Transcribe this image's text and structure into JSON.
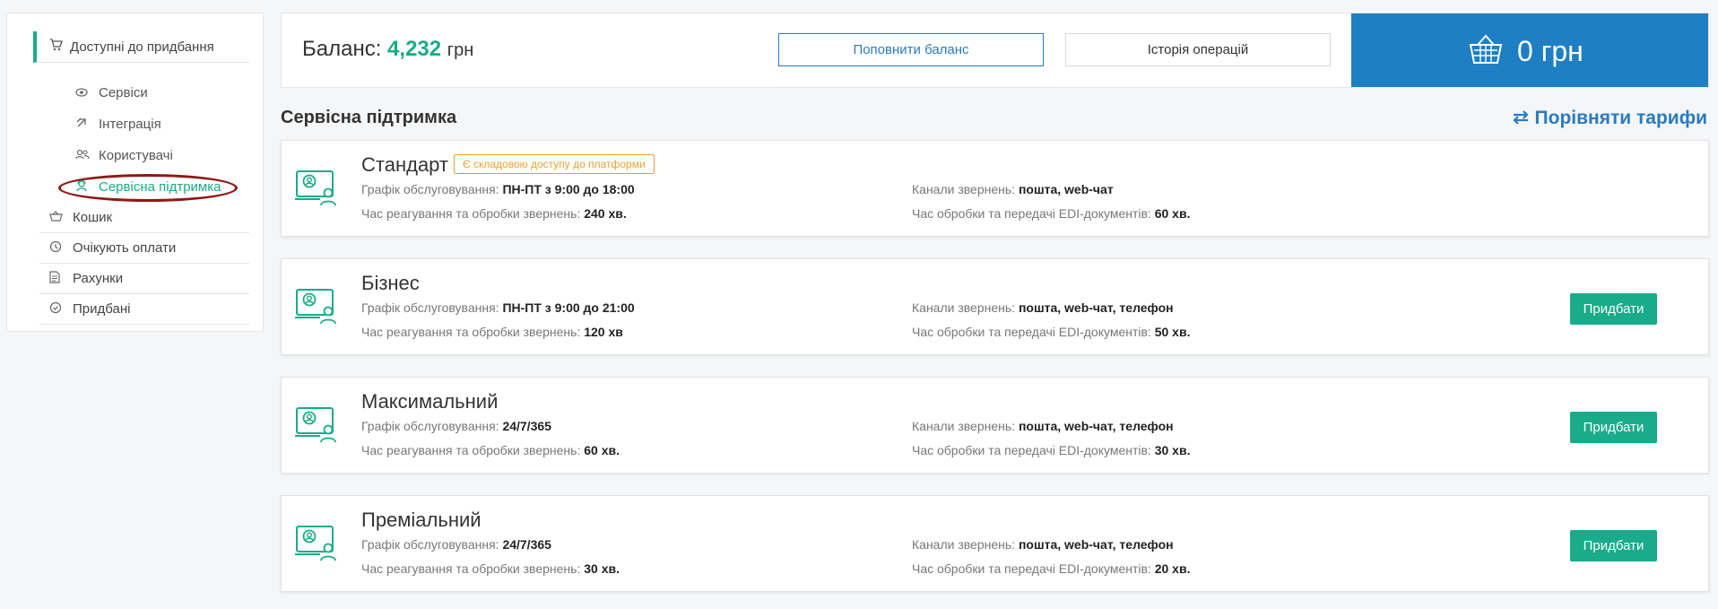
{
  "sidebar": {
    "header": {
      "label": "Доступні до придбання",
      "icon": "cart-icon"
    },
    "sub_items": [
      {
        "label": "Сервіси",
        "icon": "eye-icon",
        "active": false
      },
      {
        "label": "Інтеграція",
        "icon": "integration-icon",
        "active": false
      },
      {
        "label": "Користувачі",
        "icon": "users-icon",
        "active": false
      },
      {
        "label": "Сервісна підтримка",
        "icon": "support-icon",
        "active": true
      }
    ],
    "main_items": [
      {
        "label": "Кошик",
        "icon": "basket-icon"
      },
      {
        "label": "Очікують оплати",
        "icon": "clock-icon"
      },
      {
        "label": "Рахунки",
        "icon": "document-icon"
      },
      {
        "label": "Придбані",
        "icon": "check-circle-icon"
      }
    ]
  },
  "balance": {
    "label": "Баланс:",
    "amount": "4,232",
    "currency": "грн",
    "topup_label": "Поповнити баланс",
    "history_label": "Історія операцій",
    "cart_amount": "0 грн"
  },
  "section": {
    "title": "Сервісна підтримка",
    "compare_label": "Порівняти тарифи"
  },
  "plans": [
    {
      "name": "Стандарт",
      "badge": "Є складовою доступу до платформи",
      "schedule_label": "Графік обслуговування:",
      "schedule_value": "ПН-ПТ з 9:00 до 18:00",
      "response_label": "Час реагування та обробки звернень:",
      "response_value": "240 хв.",
      "channels_label": "Канали звернень:",
      "channels_value": "пошта, web-чат",
      "edi_label": "Час обробки та передачі EDI-документів:",
      "edi_value": "60 хв.",
      "buy_label": ""
    },
    {
      "name": "Бізнес",
      "badge": "",
      "schedule_label": "Графік обслуговування:",
      "schedule_value": "ПН-ПТ з 9:00 до 21:00",
      "response_label": "Час реагування та обробки звернень:",
      "response_value": "120 хв",
      "channels_label": "Канали звернень:",
      "channels_value": "пошта, web-чат, телефон",
      "edi_label": "Час обробки та передачі EDI-документів:",
      "edi_value": "50 хв.",
      "buy_label": "Придбати"
    },
    {
      "name": "Максимальний",
      "badge": "",
      "schedule_label": "Графік обслуговування:",
      "schedule_value": "24/7/365",
      "response_label": "Час реагування та обробки звернень:",
      "response_value": "60 хв.",
      "channels_label": "Канали звернень:",
      "channels_value": "пошта, web-чат, телефон",
      "edi_label": "Час обробки та передачі EDI-документів:",
      "edi_value": "30 хв.",
      "buy_label": "Придбати"
    },
    {
      "name": "Преміальний",
      "badge": "",
      "schedule_label": "Графік обслуговування:",
      "schedule_value": "24/7/365",
      "response_label": "Час реагування та обробки звернень:",
      "response_value": "30 хв.",
      "channels_label": "Канали звернень:",
      "channels_value": "пошта, web-чат, телефон",
      "edi_label": "Час обробки та передачі EDI-документів:",
      "edi_value": "20 хв.",
      "buy_label": "Придбати"
    }
  ],
  "colors": {
    "accent_green": "#1aab8a",
    "accent_blue": "#1e7fc4",
    "link_blue": "#2a7bbf",
    "badge_orange": "#f0a030",
    "highlight_red": "#8c1a14"
  }
}
